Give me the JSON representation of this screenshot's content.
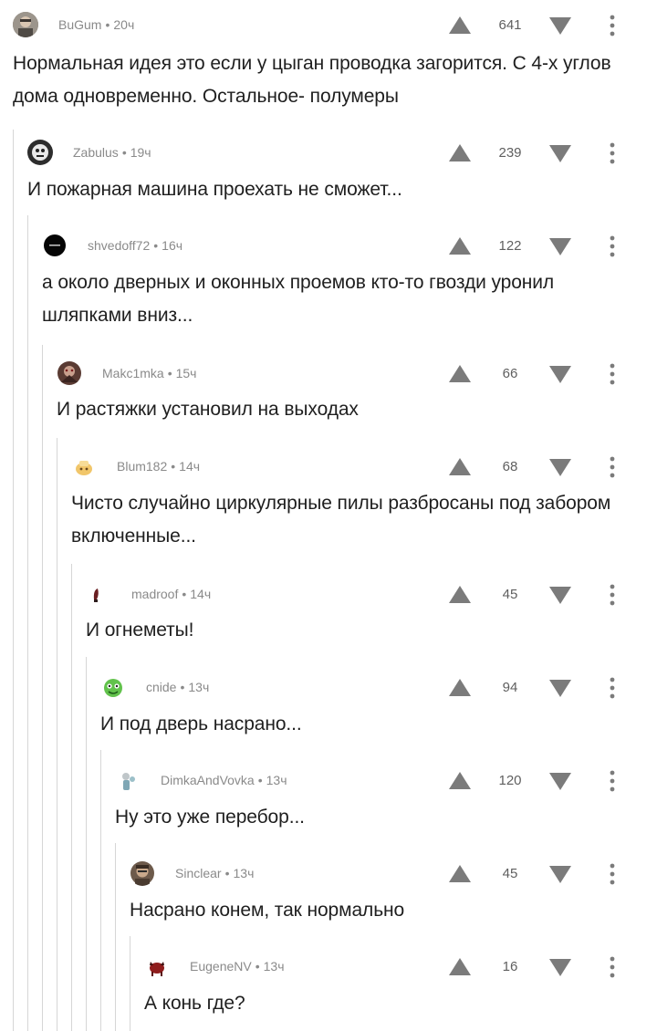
{
  "meta_separator": "•",
  "comments": [
    {
      "author": "BuGum",
      "time": "20ч",
      "rating": "641",
      "text": "Нормальная идея это если у цыган проводка загорится. С 4-х углов дома одновременно. Остальное- полумеры",
      "avatar": "avatar-bugum"
    },
    {
      "author": "Zabulus",
      "time": "19ч",
      "rating": "239",
      "text": "И пожарная машина проехать не сможет...",
      "avatar": "avatar-zabulus"
    },
    {
      "author": "shvedoff72",
      "time": "16ч",
      "rating": "122",
      "text": "а около дверных и оконных проемов кто-то гвозди уронил шляпками вниз...",
      "avatar": "avatar-shvedoff72"
    },
    {
      "author": "Makc1mka",
      "time": "15ч",
      "rating": "66",
      "text": "И растяжки установил на выходах",
      "avatar": "avatar-makc1mka"
    },
    {
      "author": "Blum182",
      "time": "14ч",
      "rating": "68",
      "text": "Чисто случайно циркулярные пилы разбросаны под забором включенные...",
      "avatar": "avatar-blum182"
    },
    {
      "author": "madroof",
      "time": "14ч",
      "rating": "45",
      "text": "И огнеметы!",
      "avatar": "avatar-madroof"
    },
    {
      "author": "cnide",
      "time": "13ч",
      "rating": "94",
      "text": "И под дверь насрано...",
      "avatar": "avatar-cnide"
    },
    {
      "author": "DimkaAndVovka",
      "time": "13ч",
      "rating": "120",
      "text": "Ну это уже перебор...",
      "avatar": "avatar-dimkaandvovka"
    },
    {
      "author": "Sinclear",
      "time": "13ч",
      "rating": "45",
      "text": "Насрано конем, так нормально",
      "avatar": "avatar-sinclear"
    },
    {
      "author": "EugeneNV",
      "time": "13ч",
      "rating": "16",
      "text": "А конь где?",
      "avatar": "avatar-eugenenv"
    }
  ],
  "icons": {
    "upvote": "upvote-arrow-icon",
    "downvote": "downvote-arrow-icon",
    "more": "more-vertical-icon"
  },
  "colors": {
    "text": "#1f1f1f",
    "meta": "#8a8a8a",
    "icon": "#7b7b7b",
    "thread_line": "#d6d6d6"
  }
}
